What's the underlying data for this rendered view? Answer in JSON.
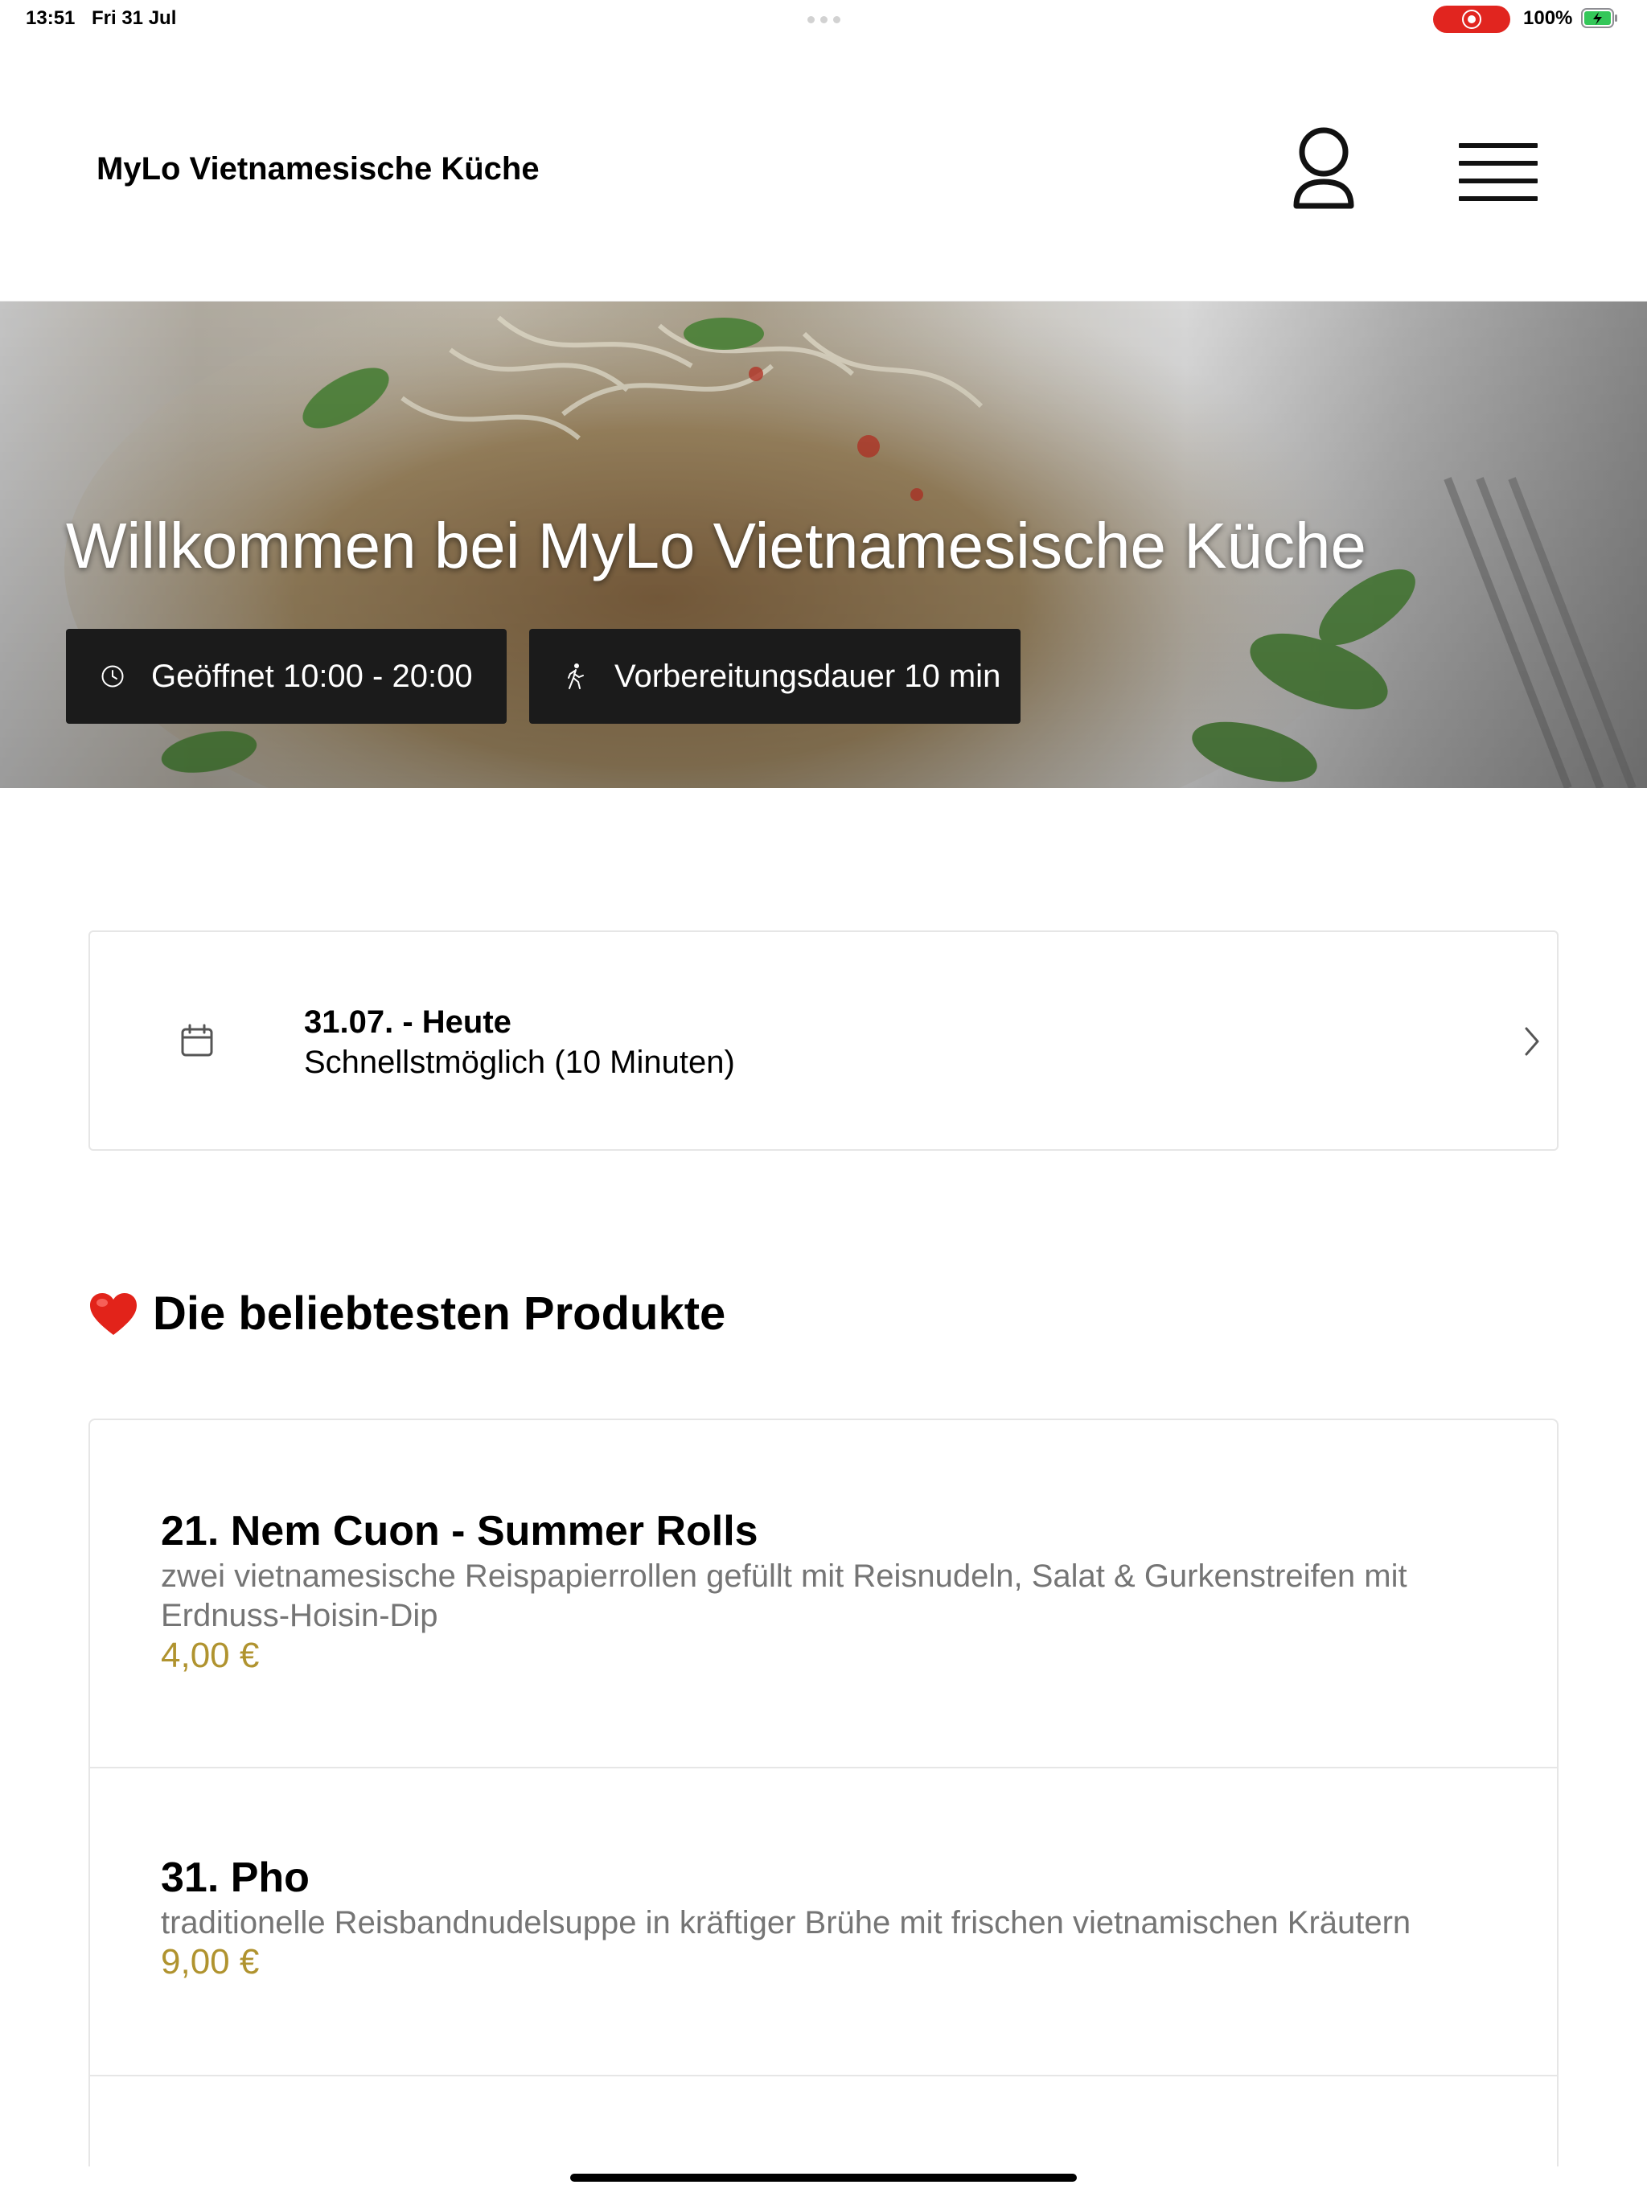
{
  "status_bar": {
    "time": "13:51",
    "date": "Fri 31 Jul",
    "battery_percent": "100%",
    "recording_color": "#e1251f",
    "battery_color": "#34c759"
  },
  "header": {
    "title": "MyLo Vietnamesische Küche",
    "profile_icon": "person-icon",
    "menu_icon": "hamburger-menu-icon"
  },
  "hero": {
    "title": "Willkommen bei MyLo Vietnamesische Küche",
    "badges": [
      {
        "icon": "clock-icon",
        "label": "Geöffnet 10:00 - 20:00"
      },
      {
        "icon": "walking-person-icon",
        "label": "Vorbereitungsdauer 10 min"
      }
    ]
  },
  "date_selector": {
    "icon": "calendar-icon",
    "date": "31.07. - Heute",
    "time_option": "Schnellstmöglich (10 Minuten)"
  },
  "popular": {
    "icon": "heart-icon",
    "title": "Die beliebtesten Produkte",
    "products": [
      {
        "name": "21. Nem Cuon - Summer Rolls",
        "description": "zwei vietnamesische Reispapierrollen gefüllt mit Reisnudeln, Salat & Gurkenstreifen mit Erdnuss-Hoisin-Dip",
        "price": "4,00 €"
      },
      {
        "name": "31. Pho",
        "description": "traditionelle Reisbandnudelsuppe in kräftiger Brühe mit frischen vietnamischen Kräutern",
        "price": "9,00 €"
      }
    ]
  },
  "colors": {
    "price": "#b0932f",
    "badge_background": "#1b1b1b",
    "accent_heart": "#e2231a"
  }
}
